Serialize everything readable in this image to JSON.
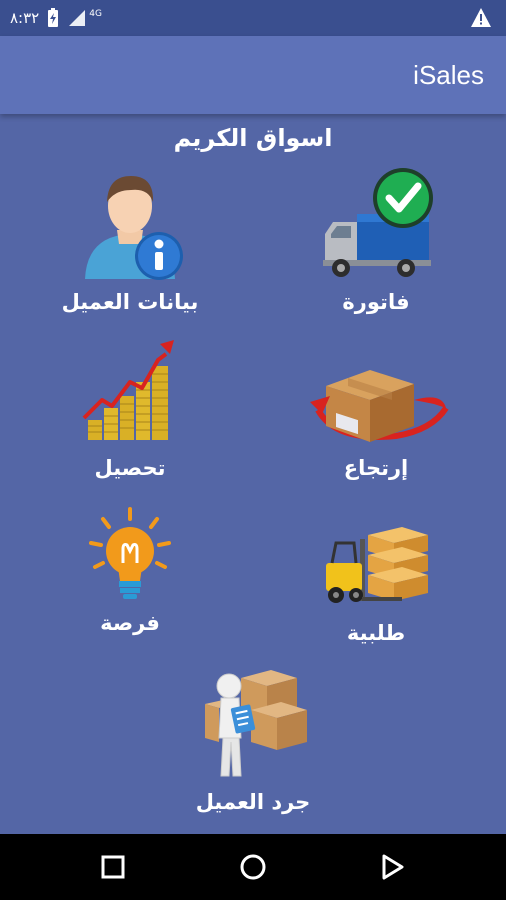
{
  "status_bar": {
    "time": "٨:٣٢",
    "network": "4G",
    "icons": [
      "battery-charging-icon",
      "signal-icon",
      "warning-icon"
    ]
  },
  "app_bar": {
    "title": "iSales"
  },
  "store": {
    "name": "اسواق الكريم"
  },
  "menu": {
    "customer_data": "بيانات العميل",
    "invoice": "فاتورة",
    "collection": "تحصيل",
    "return": "إرتجاع",
    "opportunity": "فرصة",
    "order": "طلبية",
    "customer_inventory": "جرد العميل"
  },
  "nav": {
    "icons": [
      "recents-icon",
      "home-icon",
      "back-icon"
    ]
  },
  "colors": {
    "background": "#5466a6",
    "app_bar": "#5e72b8",
    "status_bar": "#3a4f8f"
  }
}
